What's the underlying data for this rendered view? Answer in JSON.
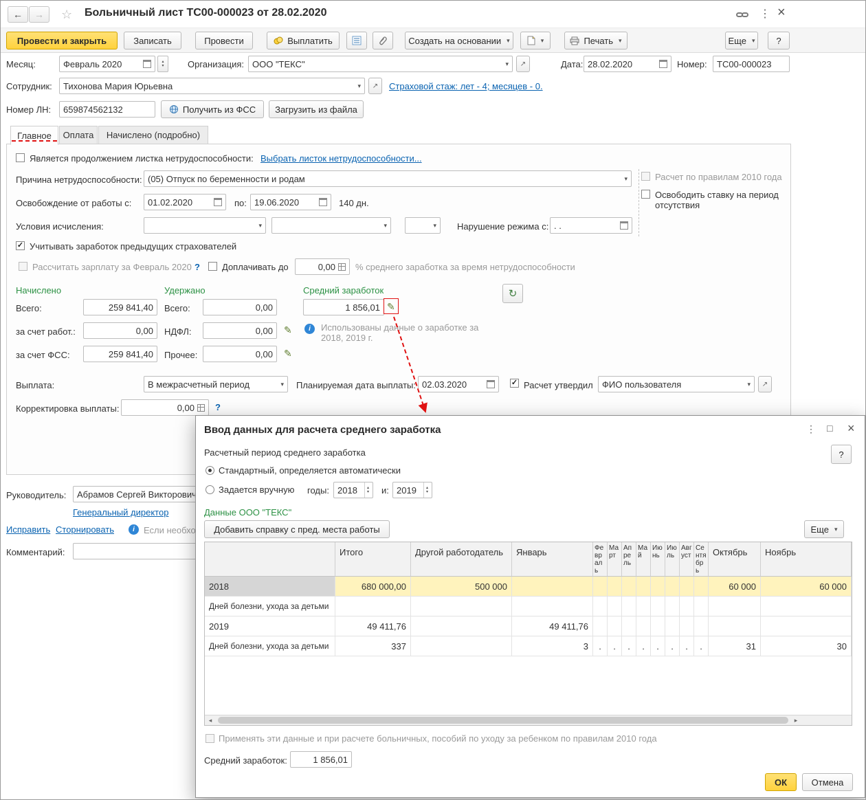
{
  "colors": {
    "accent_yellow": "#FFD23D",
    "link_blue": "#0A63B1",
    "section_green": "#2C9144",
    "row_highlight": "#FFF3BD",
    "arrow_red": "#E01212"
  },
  "icons": {
    "back": "←",
    "forward": "→",
    "star": "☆",
    "kebab": "⋮",
    "close": "×",
    "dropdown": "▾",
    "up": "▴",
    "down": "▾",
    "check": "✓",
    "pencil": "✎",
    "refresh": "↻",
    "open": "↗",
    "maximize": "□",
    "info": "i",
    "scroll_left": "◂",
    "scroll_right": "▸"
  },
  "titlebar": {
    "title": "Больничный лист ТС00-000023 от 28.02.2020"
  },
  "toolbar": {
    "post_close": "Провести и закрыть",
    "write": "Записать",
    "post": "Провести",
    "pay": "Выплатить",
    "create_based": "Создать на основании",
    "print": "Печать",
    "more": "Еще",
    "help": "?"
  },
  "header": {
    "month_label": "Месяц:",
    "month_value": "Февраль 2020",
    "org_label": "Организация:",
    "org_value": "ООО \"ТЕКС\"",
    "date_label": "Дата:",
    "date_value": "28.02.2020",
    "number_label": "Номер:",
    "number_value": "ТС00-000023",
    "employee_label": "Сотрудник:",
    "employee_value": "Тихонова Мария Юрьевна",
    "experience_link": "Страховой стаж: лет - 4; месяцев - 0.",
    "ln_label": "Номер ЛН:",
    "ln_value": "659874562132",
    "get_fss": "Получить из ФСС",
    "load_file": "Загрузить из файла"
  },
  "tabs": [
    {
      "label": "Главное"
    },
    {
      "label": "Оплата"
    },
    {
      "label": "Начислено (подробно)"
    }
  ],
  "main": {
    "continuation_label": "Является продолжением листка нетрудоспособности:",
    "choose_sheet_link": "Выбрать листок нетрудоспособности...",
    "reason_label": "Причина нетрудоспособности:",
    "reason_value": "(05) Отпуск по беременности и родам",
    "rules2010": "Расчет по правилам 2010 года",
    "free_rate": "Освободить ставку на период отсутствия",
    "release_label": "Освобождение от работы с:",
    "release_from": "01.02.2020",
    "to_label": "по:",
    "release_to": "19.06.2020",
    "days": "140 дн.",
    "conditions_label": "Условия исчисления:",
    "violation_label": "Нарушение режима с:",
    "violation_value": ". .",
    "prev_insurers": "Учитывать заработок предыдущих страхователей",
    "calc_salary": "Рассчитать зарплату за Февраль 2020",
    "q1": "?",
    "pay_up_label": "Доплачивать до",
    "pay_up_value": "0,00",
    "pay_up_suffix": "% среднего заработка за время нетрудоспособности",
    "accrued_title": "Начислено",
    "withheld_title": "Удержано",
    "avg_title": "Средний заработок",
    "total_label": "Всего:",
    "employer_label": "за счет работ.:",
    "fss_label": "за счет ФСС:",
    "ndfl_label": "НДФЛ:",
    "other_label": "Прочее:",
    "accrued_total": "259 841,40",
    "accrued_employer": "0,00",
    "accrued_fss": "259 841,40",
    "withheld_total": "0,00",
    "withheld_ndfl": "0,00",
    "withheld_other": "0,00",
    "avg_value": "1 856,01",
    "avg_info": "Использованы данные о заработке за 2018,  2019 г.",
    "payment_label": "Выплата:",
    "payment_value": "В межрасчетный период",
    "plan_date_label": "Планируемая дата выплаты:",
    "plan_date_value": "02.03.2020",
    "approved_label": "Расчет утвердил",
    "approver_value": "ФИО пользователя",
    "correction_label": "Корректировка выплаты:",
    "correction_value": "0,00"
  },
  "footer": {
    "manager_label": "Руководитель:",
    "manager_value": "Абрамов Сергей Викторович",
    "position_link": "Генеральный директор",
    "fix_link": "Исправить",
    "reverse_link": "Сторнировать",
    "note": "Если необход",
    "comment_label": "Комментарий:"
  },
  "dialog": {
    "title": "Ввод данных для расчета среднего заработка",
    "period_label": "Расчетный период среднего заработка",
    "standard_option": "Стандартный, определяется автоматически",
    "manual_option": "Задается вручную",
    "years_label": "годы:",
    "year_from": "2018",
    "and_label": "и:",
    "year_to": "2019",
    "data_title": "Данные ООО \"ТЕКС\"",
    "add_cert": "Добавить справку с пред. места работы",
    "more": "Еще",
    "help": "?",
    "table": {
      "columns": [
        "",
        "Итого",
        "Другой работодатель",
        "Январь",
        "Февраль",
        "Март",
        "Апрель",
        "Май",
        "Июнь",
        "Июль",
        "Август",
        "Сентябрь",
        "Октябрь",
        "Ноябрь"
      ],
      "rows": [
        {
          "cells": [
            "2018",
            "680 000,00",
            "500 000",
            "",
            "",
            "",
            "",
            "",
            "",
            "",
            "",
            "",
            "60 000",
            "60 000"
          ]
        },
        {
          "cells": [
            "Дней болезни, ухода за детьми",
            "",
            "",
            "",
            "",
            "",
            "",
            "",
            "",
            "",
            "",
            "",
            "",
            ""
          ]
        },
        {
          "cells": [
            "2019",
            "49 411,76",
            "",
            "49 411,76",
            "",
            "",
            "",
            "",
            "",
            "",
            "",
            "",
            "",
            ""
          ]
        },
        {
          "cells": [
            "Дней болезни, ухода за детьми",
            "337",
            "",
            "3",
            ".",
            ".",
            ".",
            ".",
            ".",
            ".",
            ".",
            ".",
            "31",
            "30"
          ]
        }
      ]
    },
    "apply2010": "Применять эти данные и при расчете больничных, пособий по уходу за ребенком по правилам 2010 года",
    "avg_label": "Средний заработок:",
    "avg_value": "1 856,01",
    "ok": "ОК",
    "cancel": "Отмена"
  }
}
